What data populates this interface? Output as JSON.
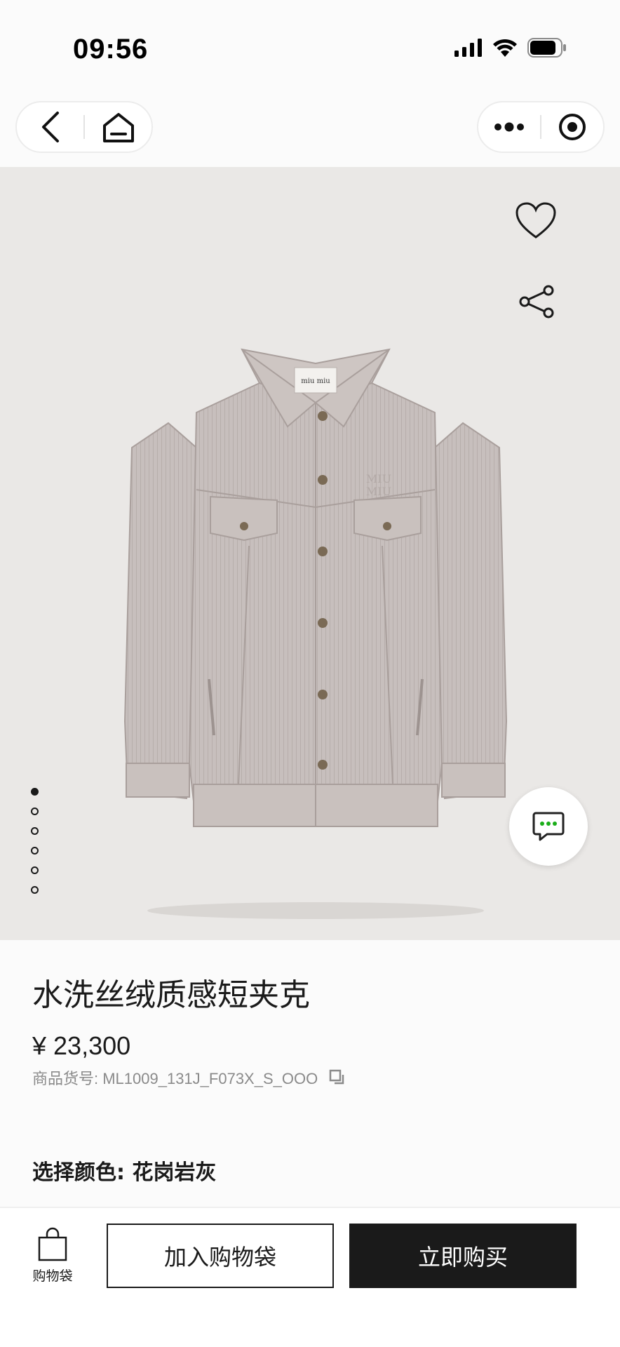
{
  "status_bar": {
    "time": "09:56",
    "icons": [
      "signal-icon",
      "wifi-icon",
      "battery-icon"
    ]
  },
  "nav": {
    "left_icons": [
      "back-icon",
      "home-icon"
    ],
    "right_icons": [
      "more-icon",
      "target-icon"
    ]
  },
  "gallery": {
    "image": "jacket-photo",
    "action_icons": [
      "heart-icon",
      "share-icon"
    ],
    "page_count": 6,
    "active_page": 1,
    "chat_icon": "chat-bubble-icon"
  },
  "product": {
    "title": "水洗丝绒质感短夹克",
    "price": "¥ 23,300",
    "sku_label": "商品货号: ML1009_131J_F073X_S_OOO",
    "sku_copy_icon": "copy-icon",
    "color_label": "选择颜色: 花岗岩灰"
  },
  "bottom_bar": {
    "bag_label": "购物袋",
    "add_to_bag": "加入购物袋",
    "buy_now": "立即购买"
  },
  "colors": {
    "accent": "#1a1a1a",
    "gallery_bg": "#eae8e6",
    "chat_dots": "#1aad19"
  }
}
